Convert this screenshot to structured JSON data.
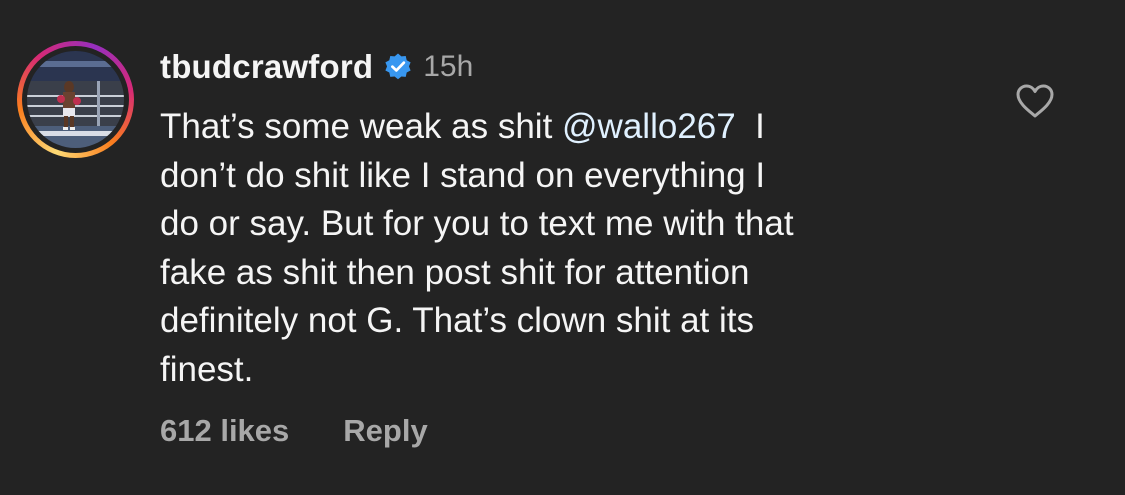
{
  "comment": {
    "username": "tbudcrawford",
    "verified": true,
    "time": "15h",
    "lines": [
      {
        "pre": "That’s some weak as shit ",
        "mention": "@wallo267",
        "post": "  I"
      },
      {
        "text": "don’t do shit like I stand on everything I"
      },
      {
        "text": "do or say. But for you to text me with that"
      },
      {
        "text": "fake as shit then post shit for attention"
      },
      {
        "text": "definitely not G. That’s clown shit at its"
      },
      {
        "text": "finest."
      }
    ],
    "likes": "612 likes",
    "reply_label": "Reply"
  },
  "icons": {
    "avatar": "avatar-boxer-photo",
    "verified": "verified-badge-icon",
    "like": "heart-outline-icon"
  },
  "colors": {
    "background": "#232323",
    "text": "#f5f5f5",
    "muted": "#a8a8a8",
    "mention": "#e0f1ff",
    "verified": "#3897f0"
  }
}
